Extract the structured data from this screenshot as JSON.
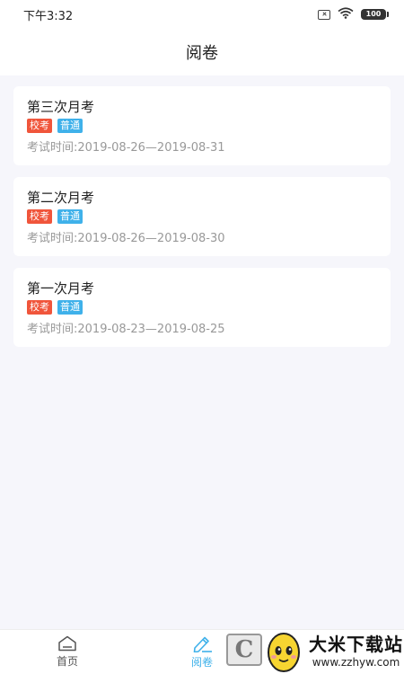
{
  "status_bar": {
    "time": "下午3:32",
    "battery": "100"
  },
  "header": {
    "title": "阅卷"
  },
  "exams": [
    {
      "title": "第三次月考",
      "tags": [
        "校考",
        "普通"
      ],
      "time": "考试时间:2019-08-26—2019-08-31"
    },
    {
      "title": "第二次月考",
      "tags": [
        "校考",
        "普通"
      ],
      "time": "考试时间:2019-08-26—2019-08-30"
    },
    {
      "title": "第一次月考",
      "tags": [
        "校考",
        "普通"
      ],
      "time": "考试时间:2019-08-23—2019-08-25"
    }
  ],
  "tabbar": {
    "home_label": "首页",
    "review_label": "阅卷",
    "active": "review"
  },
  "watermark": {
    "title": "大米下载站",
    "url": "www.zzhyw.com",
    "box_letter": "C"
  },
  "colors": {
    "accent": "#3fb1ea",
    "tag_school": "#f0553b",
    "tag_normal": "#3fb1ea",
    "background": "#f6f6fb"
  },
  "icons": {
    "sim": "sim-off-icon",
    "wifi": "wifi-icon",
    "battery": "battery-icon",
    "home": "home-icon",
    "review": "pencil-icon"
  }
}
